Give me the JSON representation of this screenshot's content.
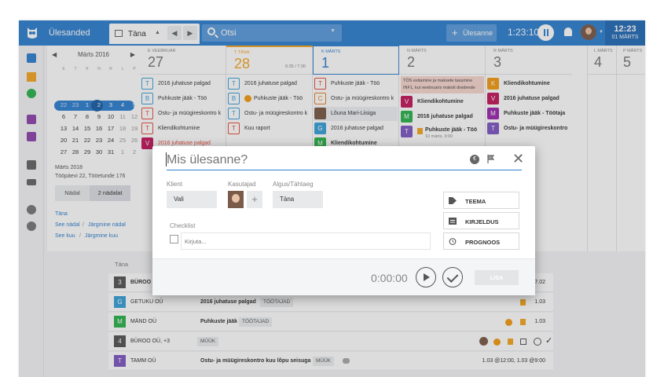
{
  "topbar": {
    "app_title": "Ülesanded",
    "today_tab": "Täna",
    "search_value": "Otsi",
    "add_button": "Ülesanne",
    "timer": "1:23:10",
    "clock_time": "12:23",
    "clock_date": "01 MÄRTS",
    "brand_color": "#2f80d1"
  },
  "calendar": {
    "month": "Märts 2016",
    "weekday_headers": [
      "E",
      "T",
      "K",
      "N",
      "R",
      "L",
      "P"
    ],
    "weeks": [
      {
        "num": "9",
        "days": [
          "29",
          "1",
          "2",
          "3",
          "4",
          "5"
        ],
        "lead": "22"
      },
      {
        "num": "10",
        "days": [
          "6",
          "7",
          "8",
          "9",
          "10",
          "11",
          "12"
        ]
      },
      {
        "num": "11",
        "days": [
          "13",
          "14",
          "15",
          "16",
          "17",
          "18",
          "19"
        ]
      },
      {
        "num": "12",
        "days": [
          "20",
          "21",
          "22",
          "23",
          "24",
          "25",
          "26"
        ]
      },
      {
        "num": "13",
        "days": [
          "27",
          "28",
          "29",
          "30",
          "31",
          "1",
          "2"
        ]
      }
    ],
    "row1": [
      "22",
      "23",
      "1",
      "2",
      "3",
      "4",
      "5"
    ],
    "info_month": "Märts 2018",
    "info_stats": "Tööpäevi 22, Tööetunde 176",
    "seg_week": "Nädal",
    "seg_2weeks": "2 nädalat",
    "link_today": "Täna",
    "link_this_week": "See nädal",
    "link_next_week": "Järgmine nädal",
    "link_this_month": "See kuu",
    "link_next_month": "Järgmine kuu"
  },
  "week": {
    "days": [
      {
        "name": "E VEEBRUAR",
        "num": "27"
      },
      {
        "name": "T TÄNA",
        "num": "28",
        "sub": "6:35 / 7:30"
      },
      {
        "name": "K MÄRTS",
        "num": "1"
      },
      {
        "name": "N MÄRTS",
        "num": "2"
      },
      {
        "name": "R MÄRTS",
        "num": "3"
      },
      {
        "name": "L MÄRTS",
        "num": "4"
      },
      {
        "name": "P MÄRTS",
        "num": "5"
      }
    ],
    "col_e": [
      "2016 juhatuse palgad",
      "Puhkuste jääk - Töö",
      "Ostu- ja müügireskontro k",
      "Kliendikohtumine",
      "2016 juhatuse palgad"
    ],
    "col_t": [
      "2016 juhatuse palgad",
      "Puhkuste jääk - Töö",
      "Ostu- ja müügireskontro k",
      "Kuu raport"
    ],
    "col_k": [
      "Puhkuste jääk - Töö",
      "Ostu- ja müügireskontro k",
      "Lõuna Mari-Liisiga",
      "2016 juhatuse palgad",
      "Kliendikohtumine"
    ],
    "col_n_note": "TÖS esitamine ja maksete tasumine INF1, kui veebruaris maksti dividende",
    "col_n": [
      "Kliendikohtumine",
      "2016 juhatuse palgad",
      "Puhkuste jääk - Töö"
    ],
    "col_n_sub": "10 märts, 9:00",
    "col_r": [
      "Kliendikohtumine",
      "2016 juhatuse palgad",
      "Puhkuste jääk - Töötaja",
      "Ostu- ja müügireskontro"
    ]
  },
  "list": {
    "label": "Täna",
    "rows": [
      {
        "badge": "3",
        "client": "BÜROO",
        "title": "",
        "chip": "",
        "date": "27.02"
      },
      {
        "badge": "G",
        "client": "GETUKU OÜ",
        "title": "2016 juhatuse palgad",
        "chip": "TÖÖTAJAD",
        "date": "1.03"
      },
      {
        "badge": "M",
        "client": "MÄND OÜ",
        "title": "Puhkuste jääk",
        "chip": "TÖÖTAJAD",
        "date": "1.03"
      },
      {
        "badge": "4",
        "client": "BÜROO OÜ, +3",
        "title": "",
        "chip": "MÜÜK",
        "date": ""
      },
      {
        "badge": "T",
        "client": "TAMM OÜ",
        "title": "Ostu- ja müügireskontro kuu lõpu seisuga",
        "chip": "MÜÜK",
        "date": "1.03 @12:00, 1.03 @9:00"
      }
    ]
  },
  "modal": {
    "title_placeholder": "Mis ülesanne?",
    "client_label": "Klient",
    "client_value": "Vali",
    "users_label": "Kasutajad",
    "start_label": "Algus/Tähtaeg",
    "start_value": "Täna",
    "checklist_label": "Checklist",
    "checklist_placeholder": "Kirjuta...",
    "btn_theme": "TEEMA",
    "btn_desc": "KIRJELDUS",
    "btn_forecast": "PROGNOOS",
    "timer": "0:00:00",
    "submit": "LISA"
  }
}
